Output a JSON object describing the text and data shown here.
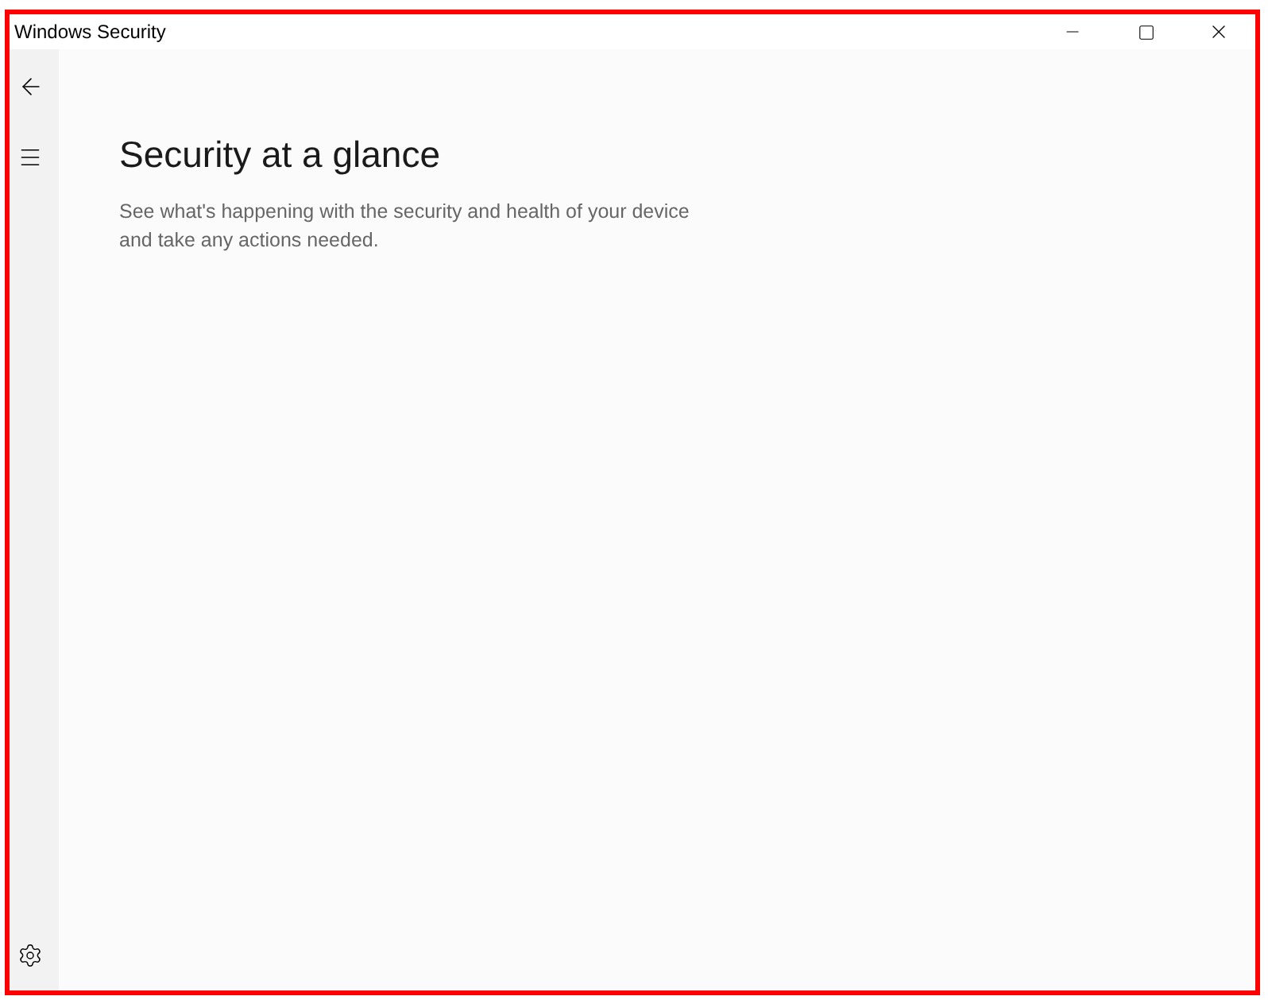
{
  "window": {
    "title": "Windows Security"
  },
  "page": {
    "heading": "Security at a glance",
    "description": "See what's happening with the security and health of your device and take any actions needed."
  }
}
